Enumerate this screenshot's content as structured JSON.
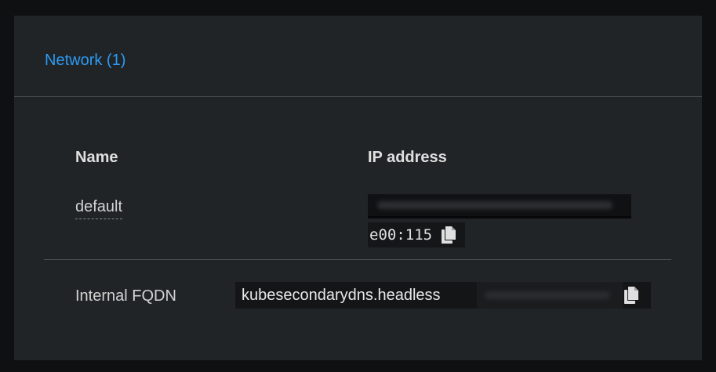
{
  "network": {
    "title": "Network (1)",
    "columns": {
      "name": "Name",
      "ip": "IP address"
    },
    "rows": [
      {
        "name": "default",
        "ip_visible_suffix": "e00:115"
      }
    ]
  },
  "fqdn": {
    "label": "Internal FQDN",
    "value": "kubesecondarydns.headless"
  },
  "icons": {
    "copy": "copy-icon"
  },
  "colors": {
    "link": "#2b9af3",
    "card_bg": "#212427",
    "page_bg": "#0f1012"
  }
}
